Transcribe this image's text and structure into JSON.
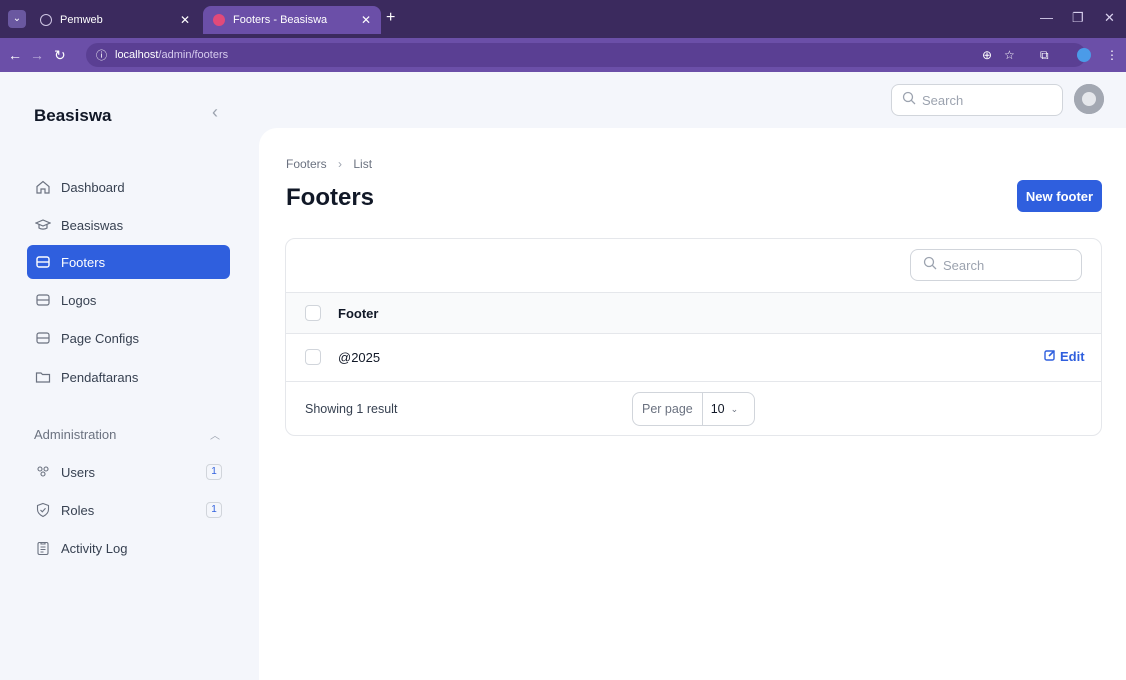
{
  "browser": {
    "tabs": [
      {
        "title": "Pemweb",
        "active": false
      },
      {
        "title": "Footers - Beasiswa",
        "active": true
      }
    ],
    "url_host": "localhost",
    "url_path": "/admin/footers",
    "accent": "#6b4fa8"
  },
  "app": {
    "brand": "Beasiswa",
    "accent": "#2f5fde"
  },
  "sidebar": {
    "items": [
      {
        "label": "Dashboard",
        "icon": "home-icon",
        "active": false
      },
      {
        "label": "Beasiswas",
        "icon": "academic-cap-icon",
        "active": false
      },
      {
        "label": "Footers",
        "icon": "inbox-icon",
        "active": true
      },
      {
        "label": "Logos",
        "icon": "inbox-icon",
        "active": false
      },
      {
        "label": "Page Configs",
        "icon": "inbox-icon",
        "active": false
      },
      {
        "label": "Pendaftarans",
        "icon": "folder-icon",
        "active": false
      }
    ],
    "group_label": "Administration",
    "admin_items": [
      {
        "label": "Users",
        "icon": "users-icon",
        "badge": "1"
      },
      {
        "label": "Roles",
        "icon": "shield-check-icon",
        "badge": "1"
      },
      {
        "label": "Activity Log",
        "icon": "clipboard-icon",
        "badge": ""
      }
    ]
  },
  "topbar": {
    "search_placeholder": "Search"
  },
  "page": {
    "breadcrumb": [
      "Footers",
      "List"
    ],
    "title": "Footers",
    "new_button": "New footer"
  },
  "table": {
    "search_placeholder": "Search",
    "column_header": "Footer",
    "rows": [
      {
        "footer": "@2025",
        "action": "Edit"
      }
    ],
    "summary": "Showing 1 result",
    "per_page_label": "Per page",
    "per_page_value": "10"
  }
}
